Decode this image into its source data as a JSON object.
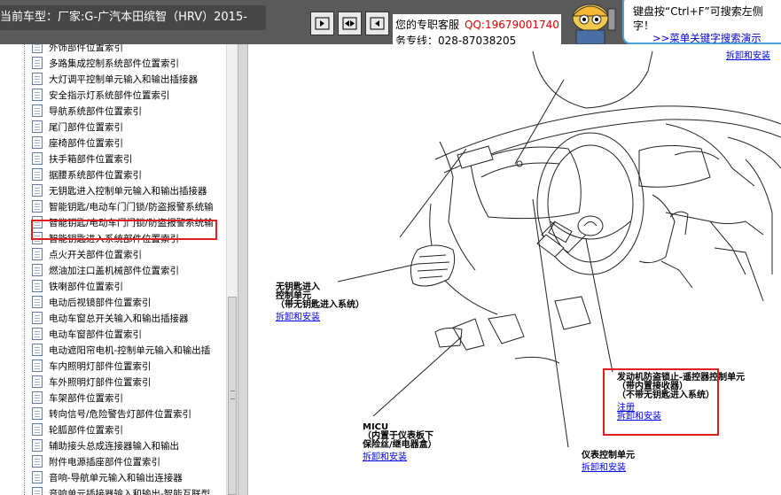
{
  "header": {
    "vehicle_text": "当前车型：厂家:G-广汽本田缤智（HRV）2015-",
    "buttons": [
      {
        "name": "prev-button",
        "icon": "arrow-right-icon"
      },
      {
        "name": "expand-button",
        "icon": "double-arrow-icon"
      },
      {
        "name": "next-button",
        "icon": "arrow-left-icon"
      }
    ],
    "service_label": "您的专职客服",
    "qq": "QQ:19679001740",
    "hotline": "务专线：028-87038205",
    "tip_line1": "键盘按“Ctrl+F”可搜索左侧",
    "tip_line2": "字！",
    "tip_link": ">>菜单关键字搜索演示"
  },
  "tree": {
    "items": [
      "外饰部件位置索引",
      "多路集成控制系统部件位置索引",
      "大灯调平控制单元输入和输出插接器",
      "安全指示灯系统部件位置索引",
      "导航系统部件位置索引",
      "尾门部件位置索引",
      "座椅部件位置索引",
      "扶手箱部件位置索引",
      "据腰系统部件位置索引",
      "无钥匙进入控制单元输入和输出插接器",
      "智能钥匙/电动车门门锁/防盗报警系统输",
      "智能钥匙/电动车门门锁/防盗报警系统输",
      "智能钥匙进入系统部件位置索引",
      "点火开关部件位置索引",
      "燃油加注口盖机械部件位置索引",
      "铁喇部件位置索引",
      "电动后视镜部件位置索引",
      "电动车窗总开关输入和输出插接器",
      "电动车窗部件位置索引",
      "电动遮阳帘电机-控制单元输入和输出插",
      "车内照明灯部件位置索引",
      "车外照明灯部件位置索引",
      "车架部件位置索引",
      "转向信号/危险警告灯部件位置索引",
      "轮胍部件位置索引",
      "辅助接头总成连接器输入和输出",
      "附件电源插座部件位置索引",
      "音响-导航单元输入和输出连接器",
      "音响单元插接器输入和输出-智能互联型"
    ]
  },
  "diagram": {
    "top_link": "拆卸和安装",
    "keyless": {
      "line1": "无钥匙进入",
      "line2": "控制单元",
      "line3": "（带无钥匙进入系统）",
      "link": "拆卸和安装"
    },
    "micu": {
      "line1": "MICU",
      "line2": "（内置于仪表板下",
      "line3": "保险丝/继电器盒）",
      "link": "拆卸和安装"
    },
    "gauge": {
      "line1": "仪表控制单元",
      "link": "拆卸和安装"
    },
    "immobilizer": {
      "line1": "发动机防盗锁止-遥控器控制单元",
      "line2": "（带内置接收器）",
      "line3": "（不带无钥匙进入系统）",
      "link1": "注册",
      "link2": "拆卸和安装"
    }
  }
}
